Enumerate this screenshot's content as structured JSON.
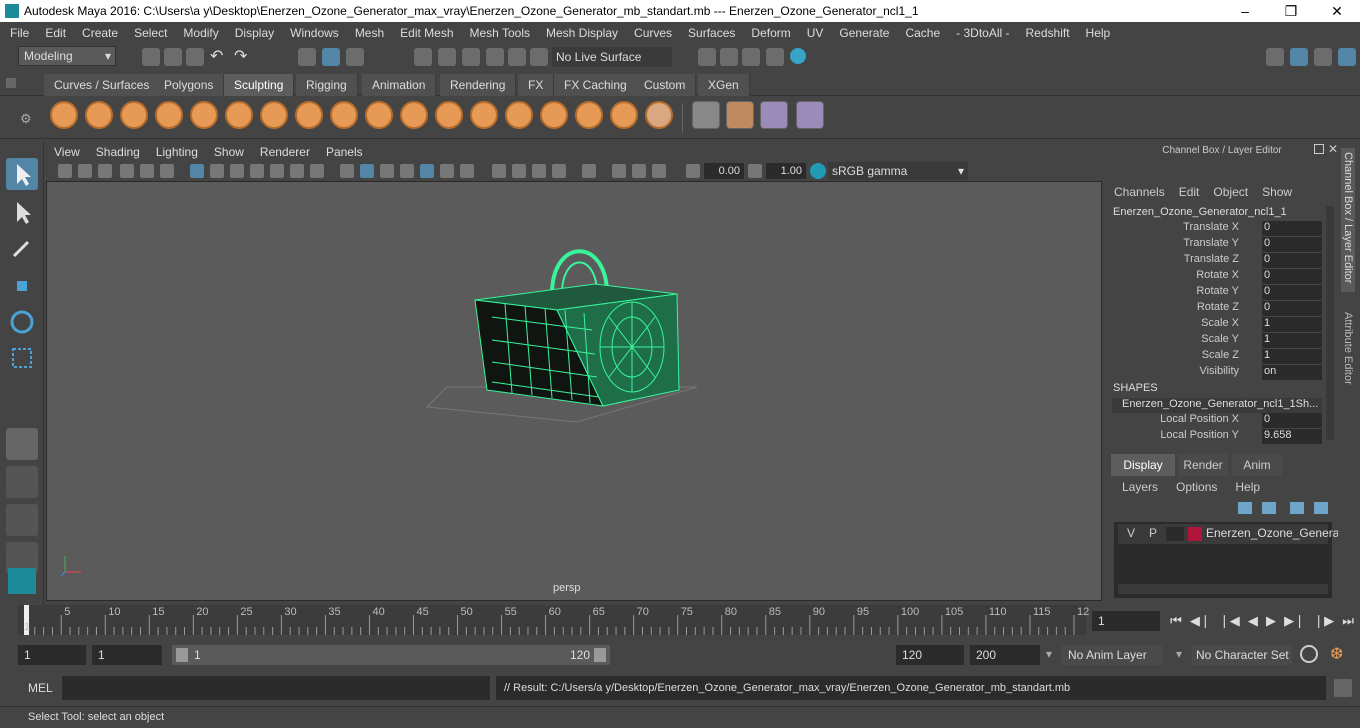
{
  "title": "Autodesk Maya 2016: C:\\Users\\a y\\Desktop\\Enerzen_Ozone_Generator_max_vray\\Enerzen_Ozone_Generator_mb_standart.mb   ---   Enerzen_Ozone_Generator_ncl1_1",
  "menubar": [
    "File",
    "Edit",
    "Create",
    "Select",
    "Modify",
    "Display",
    "Windows",
    "Mesh",
    "Edit Mesh",
    "Mesh Tools",
    "Mesh Display",
    "Curves",
    "Surfaces",
    "Deform",
    "UV",
    "Generate",
    "Cache",
    "- 3DtoAll -",
    "Redshift",
    "Help"
  ],
  "statusline": {
    "mode": "Modeling",
    "live_surface": "No Live Surface"
  },
  "shelf_tabs": [
    "Curves / Surfaces",
    "Polygons",
    "Sculpting",
    "Rigging",
    "Animation",
    "Rendering",
    "FX",
    "FX Caching",
    "Custom",
    "XGen"
  ],
  "active_shelf_tab": "Sculpting",
  "viewport_menu": [
    "View",
    "Shading",
    "Lighting",
    "Show",
    "Renderer",
    "Panels"
  ],
  "viewport_toolbar": {
    "field1": "0.00",
    "field2": "1.00",
    "colorspace": "sRGB gamma"
  },
  "camera_label": "persp",
  "channel_box": {
    "header": "Channel Box / Layer Editor",
    "menus": [
      "Channels",
      "Edit",
      "Object",
      "Show"
    ],
    "object_name": "Enerzen_Ozone_Generator_ncl1_1",
    "attributes": [
      {
        "name": "Translate X",
        "value": "0"
      },
      {
        "name": "Translate Y",
        "value": "0"
      },
      {
        "name": "Translate Z",
        "value": "0"
      },
      {
        "name": "Rotate X",
        "value": "0"
      },
      {
        "name": "Rotate Y",
        "value": "0"
      },
      {
        "name": "Rotate Z",
        "value": "0"
      },
      {
        "name": "Scale X",
        "value": "1"
      },
      {
        "name": "Scale Y",
        "value": "1"
      },
      {
        "name": "Scale Z",
        "value": "1"
      },
      {
        "name": "Visibility",
        "value": "on"
      }
    ],
    "shapes_label": "SHAPES",
    "shape_name": "Enerzen_Ozone_Generator_ncl1_1Sh...",
    "shape_attributes": [
      {
        "name": "Local Position X",
        "value": "0"
      },
      {
        "name": "Local Position Y",
        "value": "9.658"
      }
    ]
  },
  "layer_editor": {
    "tabs": [
      "Display",
      "Render",
      "Anim"
    ],
    "active_tab": "Display",
    "menus": [
      "Layers",
      "Options",
      "Help"
    ],
    "layer": {
      "v": "V",
      "p": "P",
      "name": "Enerzen_Ozone_Generat",
      "color": "#b0163b"
    }
  },
  "side_tabs": [
    "Channel Box / Layer Editor",
    "Attribute Editor"
  ],
  "timeline": {
    "ticks": [
      "5",
      "10",
      "15",
      "20",
      "25",
      "30",
      "35",
      "40",
      "45",
      "50",
      "55",
      "60",
      "65",
      "70",
      "75",
      "80",
      "85",
      "90",
      "95",
      "100",
      "105",
      "110",
      "115",
      "12"
    ],
    "first": "1",
    "current_frame": "1"
  },
  "range": {
    "start": "1",
    "playback_start": "1",
    "slider_start": "1",
    "slider_end": "120",
    "playback_end": "120",
    "end": "200",
    "anim_layer": "No Anim Layer",
    "char_set": "No Character Set"
  },
  "mel": {
    "label": "MEL",
    "result": "// Result: C:/Users/a y/Desktop/Enerzen_Ozone_Generator_max_vray/Enerzen_Ozone_Generator_mb_standart.mb"
  },
  "help_line": "Select Tool: select an object",
  "colors": {
    "wire": "#39f59a",
    "accent": "#5285a6",
    "shelf_icon": "#e79a55"
  }
}
